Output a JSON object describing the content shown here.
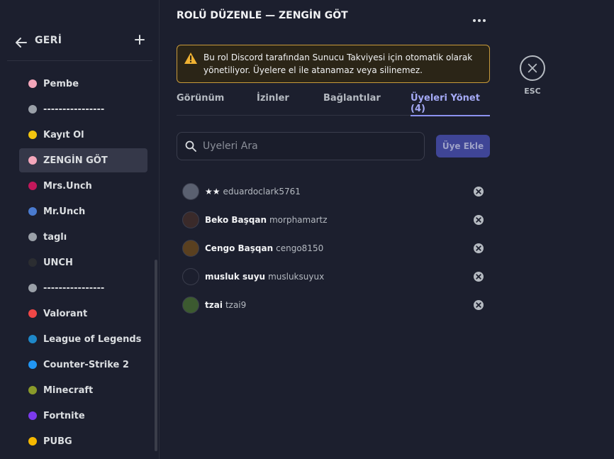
{
  "sidebar": {
    "back_label": "GERİ",
    "roles": [
      {
        "name": "Pembe",
        "color": "#f4a7bb",
        "active": false
      },
      {
        "name": "----------------",
        "color": "#9aa0a8",
        "active": false
      },
      {
        "name": "Kayıt Ol",
        "color": "#f1c40f",
        "active": false
      },
      {
        "name": "ZENGİN GÖT",
        "color": "#f4a7bb",
        "active": true
      },
      {
        "name": "Mrs.Unch",
        "color": "#c2185b",
        "active": false
      },
      {
        "name": "Mr.Unch",
        "color": "#4a7bd0",
        "active": false
      },
      {
        "name": "taglı",
        "color": "#9aa0a8",
        "active": false
      },
      {
        "name": "UNCH",
        "color": "#2b2d31",
        "active": false
      },
      {
        "name": "----------------",
        "color": "#9aa0a8",
        "active": false
      },
      {
        "name": "Valorant",
        "color": "#f04747",
        "active": false
      },
      {
        "name": "League of Legends",
        "color": "#1e88c9",
        "active": false
      },
      {
        "name": "Counter-Strike 2",
        "color": "#2196f3",
        "active": false
      },
      {
        "name": "Minecraft",
        "color": "#8a9a2a",
        "active": false
      },
      {
        "name": "Fortnite",
        "color": "#7c3aed",
        "active": false
      },
      {
        "name": "PUBG",
        "color": "#f5b800",
        "active": false
      }
    ]
  },
  "main": {
    "title": "ROLÜ DÜZENLE — ZENGİN GÖT",
    "warning": "Bu rol Discord tarafından Sunucu Takviyesi için otomatik olarak yönetiliyor. Üyelere el ile atanamaz veya silinemez.",
    "tabs": [
      {
        "label": "Görünüm",
        "active": false
      },
      {
        "label": "İzinler",
        "active": false
      },
      {
        "label": "Bağlantılar",
        "active": false
      },
      {
        "label": "Üyeleri Yönet (4)",
        "active": true
      }
    ],
    "search_placeholder": "Üyeleri Ara",
    "add_member_label": "Üye Ekle",
    "members": [
      {
        "display": "★★",
        "username": "eduardoclark5761",
        "avatar_color": "#5a6070"
      },
      {
        "display": "Beko Başqan",
        "username": "morphamartz",
        "avatar_color": "#3a2a2a"
      },
      {
        "display": "Cengo Başqan",
        "username": "cengo8150",
        "avatar_color": "#5a4020"
      },
      {
        "display": "musluk suyu",
        "username": "musluksuyux",
        "avatar_color": "#1c1f2e"
      },
      {
        "display": "tzai",
        "username": "tzai9",
        "avatar_color": "#3c5a30"
      }
    ]
  },
  "esc_label": "ESC",
  "colors": {
    "accent": "#8c92f0",
    "warning_border": "#c89a3a",
    "background": "#1c1f2e"
  }
}
